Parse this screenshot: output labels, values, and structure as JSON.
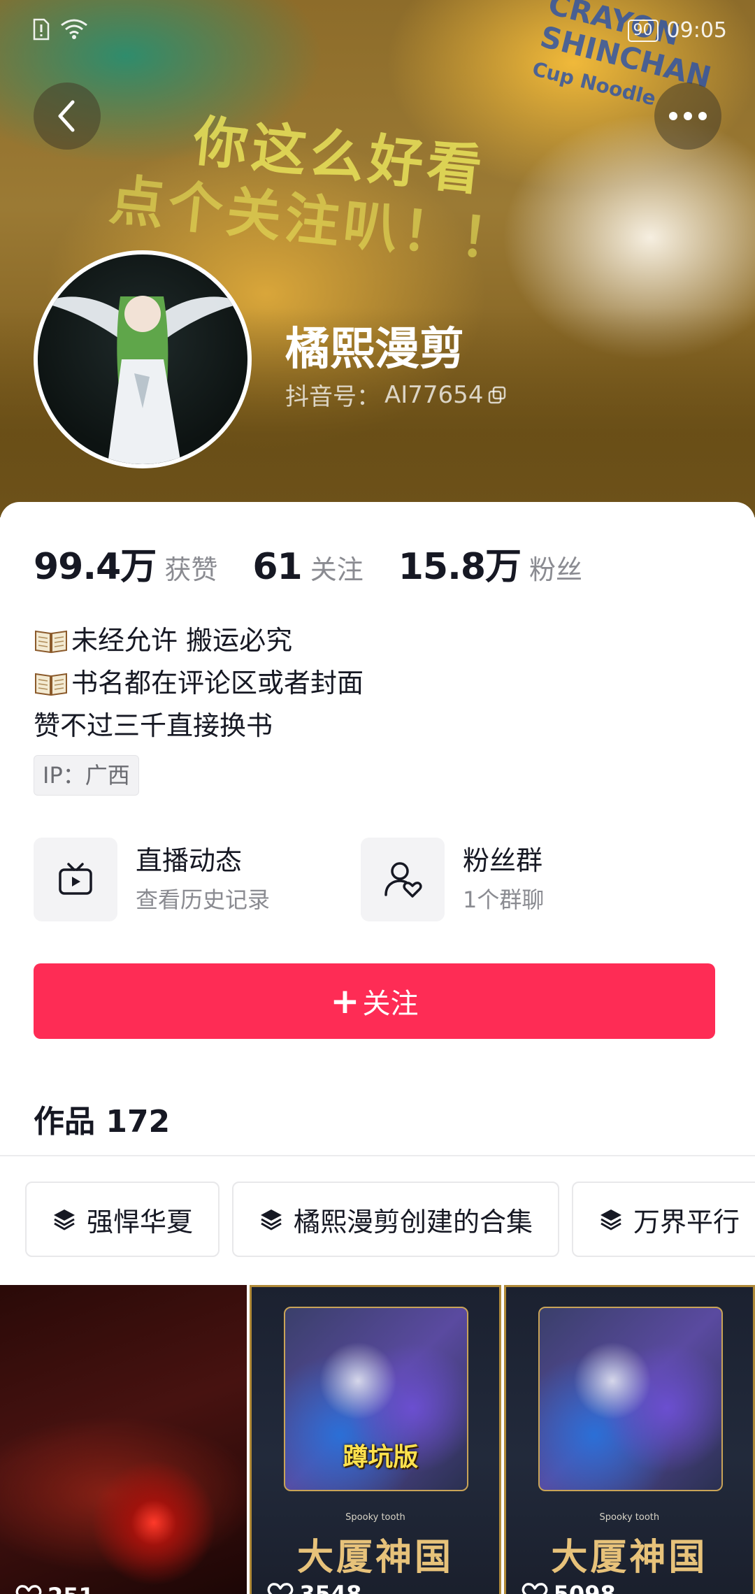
{
  "status_bar": {
    "time": "09:05",
    "battery": "90"
  },
  "banner": {
    "slogan_line1": "你这么好看",
    "slogan_line2": "点个关注叭！！",
    "cup_text_1": "CRAYON",
    "cup_text_2": "SHINCHAN",
    "cup_text_3": "Cup Noodle"
  },
  "profile": {
    "nickname": "橘熙漫剪",
    "douyin_id_label": "抖音号：",
    "douyin_id": "AI77654"
  },
  "stats": [
    {
      "value": "99.4万",
      "label": "获赞"
    },
    {
      "value": "61",
      "label": "关注"
    },
    {
      "value": "15.8万",
      "label": "粉丝"
    }
  ],
  "bio": {
    "line1": "未经允许 搬运必究",
    "line2": "书名都在评论区或者封面",
    "line3": "赞不过三千直接换书"
  },
  "ip_tag": "IP：广西",
  "features": {
    "live": {
      "title": "直播动态",
      "subtitle": "查看历史记录",
      "icon": "tv-icon"
    },
    "fans": {
      "title": "粉丝群",
      "subtitle": "1个群聊",
      "icon": "user-heart-icon"
    }
  },
  "follow_button": {
    "label": "关注"
  },
  "works": {
    "label": "作品",
    "count": "172"
  },
  "collections": [
    {
      "label": "强悍华夏"
    },
    {
      "label": "橘熙漫剪创建的合集"
    },
    {
      "label": "万界平行"
    }
  ],
  "videos": [
    {
      "likes": "251"
    },
    {
      "likes": "3548",
      "badge": "蹲坑版",
      "caption_small": "Spooky tooth",
      "caption": "大厦神国"
    },
    {
      "likes": "5098",
      "caption_small": "Spooky tooth",
      "caption": "大厦神国"
    }
  ],
  "colors": {
    "accent": "#fe2c55",
    "text": "#161823",
    "muted": "#8a8b91"
  }
}
